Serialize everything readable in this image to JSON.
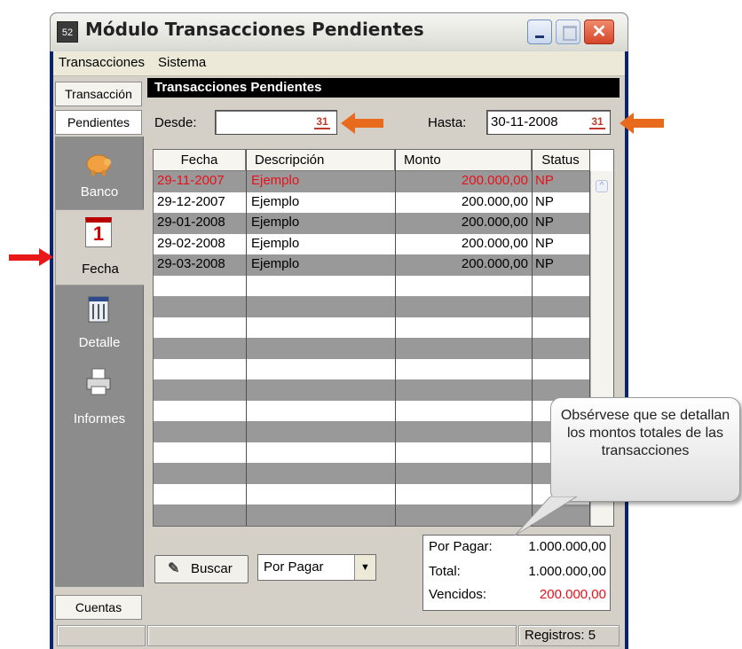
{
  "window": {
    "title": "Módulo Transacciones Pendientes",
    "icon_text": "52",
    "close_symbol": "✕"
  },
  "menu": [
    "Transacciones",
    "Sistema"
  ],
  "left_tabs": {
    "transaccion": "Transacción",
    "pendientes": "Pendientes",
    "cuentas": "Cuentas"
  },
  "sidebar": [
    {
      "label": "Banco",
      "icon": "piggy-bank-icon"
    },
    {
      "label": "Fecha",
      "icon": "calendar-icon",
      "icon_text": "1"
    },
    {
      "label": "Detalle",
      "icon": "ledger-icon"
    },
    {
      "label": "Informes",
      "icon": "printer-icon"
    }
  ],
  "panel_title": "Transacciones Pendientes",
  "desde": {
    "label": "Desde:",
    "value": ""
  },
  "hasta": {
    "label": "Hasta:",
    "value": "30-11-2008"
  },
  "grid": {
    "columns": [
      "Fecha",
      "Descripción",
      "Monto",
      "Status"
    ],
    "rows": [
      {
        "fecha": "29-11-2007",
        "descripcion": "Ejemplo",
        "monto": "200.000,00",
        "status": "NP",
        "overdue": true
      },
      {
        "fecha": "29-12-2007",
        "descripcion": "Ejemplo",
        "monto": "200.000,00",
        "status": "NP",
        "overdue": false
      },
      {
        "fecha": "29-01-2008",
        "descripcion": "Ejemplo",
        "monto": "200.000,00",
        "status": "NP",
        "overdue": false
      },
      {
        "fecha": "29-02-2008",
        "descripcion": "Ejemplo",
        "monto": "200.000,00",
        "status": "NP",
        "overdue": false
      },
      {
        "fecha": "29-03-2008",
        "descripcion": "Ejemplo",
        "monto": "200.000,00",
        "status": "NP",
        "overdue": false
      }
    ]
  },
  "buscar_button": {
    "label": "Buscar"
  },
  "filter": {
    "selected": "Por Pagar"
  },
  "totals": {
    "por_pagar": {
      "label": "Por Pagar:",
      "value": "1.000.000,00"
    },
    "total": {
      "label": "Total:",
      "value": "1.000.000,00"
    },
    "vencidos": {
      "label": "Vencidos:",
      "value": "200.000,00"
    }
  },
  "status": {
    "registros": "Registros: 5"
  },
  "callout": "Obsérvese que se detallan los montos totales de las transacciones",
  "colors": {
    "overdue_red": "#e8101a",
    "arrow_orange": "#e86a1c",
    "pointer_red": "#e81818",
    "alt_row": "#999999"
  }
}
